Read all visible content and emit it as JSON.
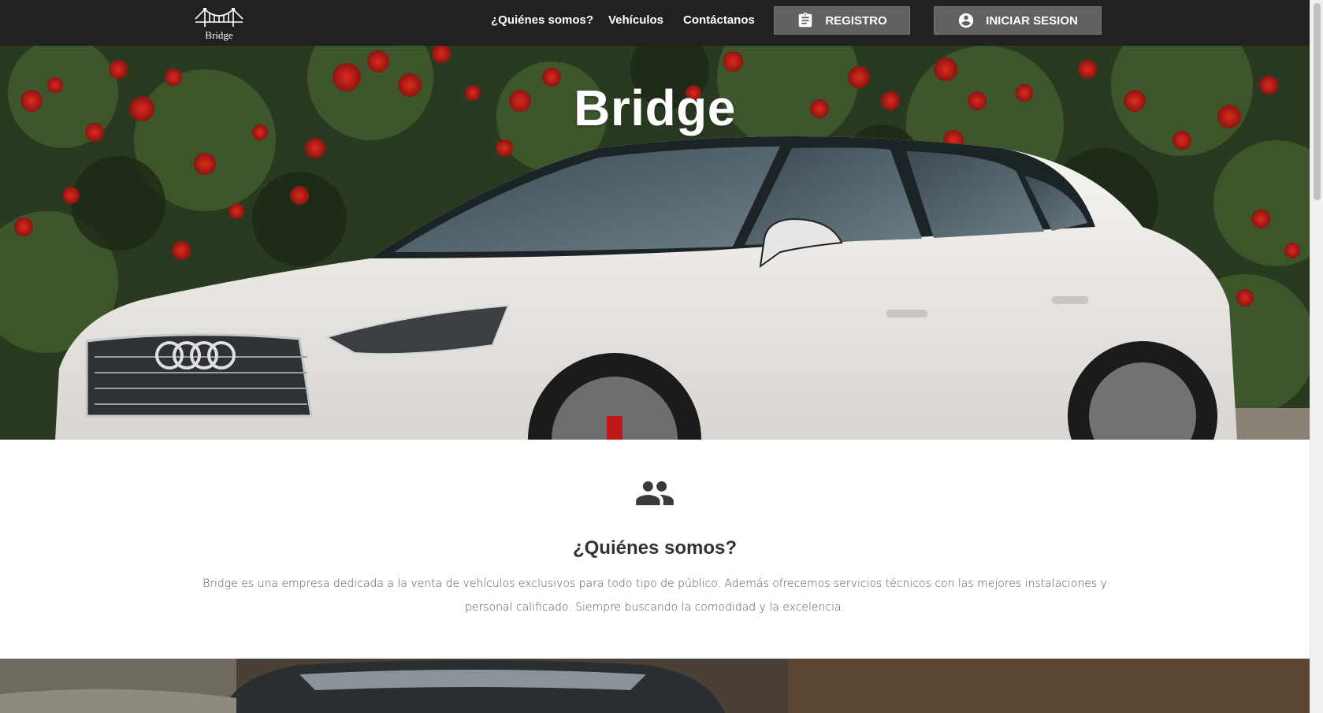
{
  "navbar": {
    "brand": {
      "name": "Bridge",
      "icon": "bridge-logo-icon"
    },
    "links": [
      {
        "label": "¿Quiénes somos?"
      },
      {
        "label": "Vehículos"
      },
      {
        "label": "Contáctanos"
      }
    ],
    "register_button": {
      "label": "REGISTRO",
      "icon": "clipboard-icon"
    },
    "login_button": {
      "label": "INICIAR SESION",
      "icon": "account-circle-icon"
    }
  },
  "hero": {
    "title": "Bridge"
  },
  "about": {
    "icon": "people-icon",
    "title": "¿Quiénes somos?",
    "text": "Bridge es una empresa dedicada a la venta de vehículos exclusivos para todo tipo de público. Además ofrecemos servicios técnicos con las mejores instalaciones y personal calificado. Siempre buscando la comodidad y la excelencia."
  },
  "colors": {
    "navbar_bg": "#212121",
    "nav_button_bg": "#616161",
    "text_dark": "#333333",
    "text_body": "#555555"
  }
}
